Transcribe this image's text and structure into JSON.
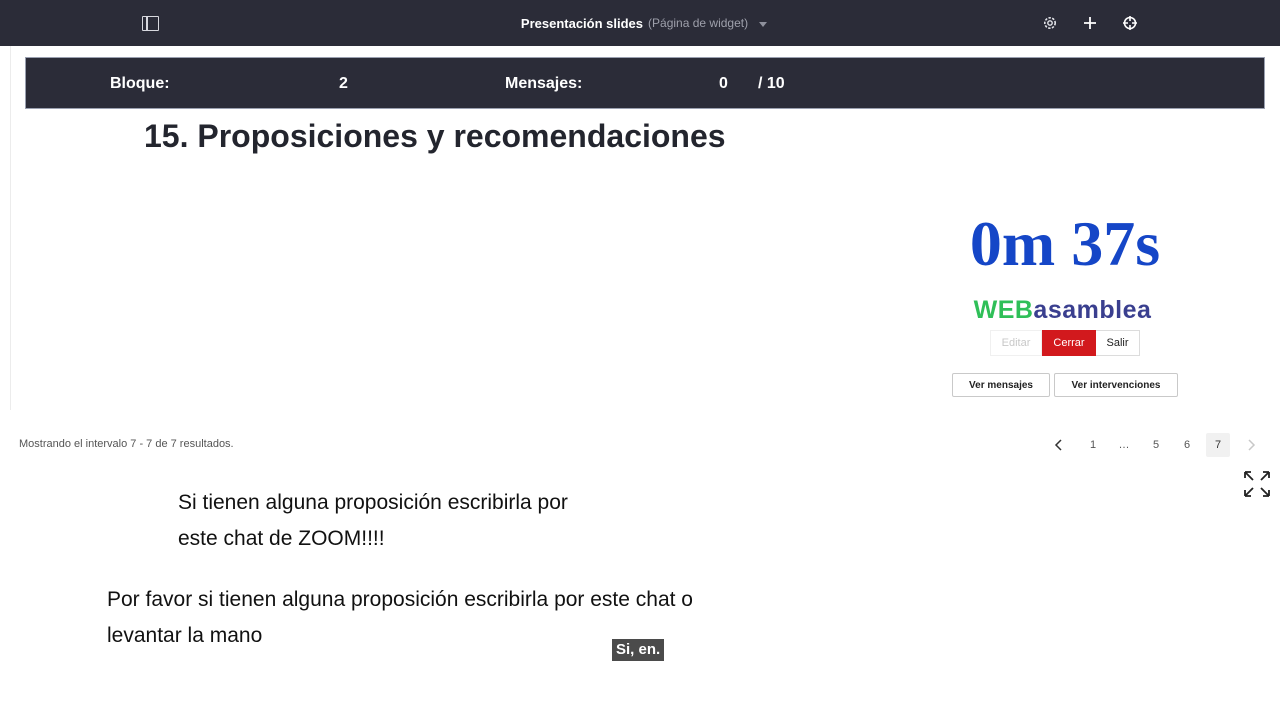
{
  "app": {
    "title": "Presentación slides",
    "subtitle": "(Página de widget)"
  },
  "status_bar": {
    "block_label": "Bloque:",
    "block_value": "2",
    "messages_label": "Mensajes:",
    "messages_value": "0",
    "messages_total": "/ 10"
  },
  "slide": {
    "heading": "15. Proposiciones y recomendaciones",
    "timer": "0m 37s",
    "logo_part1": "WEB",
    "logo_part2": "asamblea",
    "edit_label": "Editar",
    "close_label": "Cerrar",
    "exit_label": "Salir",
    "view_messages_label": "Ver mensajes",
    "view_interventions_label": "Ver intervenciones"
  },
  "pagination": {
    "summary": "Mostrando el intervalo 7 - 7 de 7 resultados.",
    "pages": [
      "1",
      "…",
      "5",
      "6",
      "7"
    ],
    "current": "7"
  },
  "captions": {
    "line1a": "Si tienen alguna proposición escribirla por",
    "line1b": "este chat de ZOOM!!!!",
    "line2a": "Por favor si tienen alguna proposición escribirla por este chat o",
    "line2b": "levantar la mano",
    "live_subtitle": "Si, en."
  },
  "colors": {
    "topbar": "#2b2c38",
    "timer": "#1546c7",
    "logo_web": "#2fbf58",
    "logo_asamblea": "#3a3f8f",
    "close_button": "#d2191d"
  },
  "icons": {
    "sidebar": "sidebar-toggle-icon",
    "settings": "gear-icon",
    "add": "plus-icon",
    "target": "crosshair-icon",
    "prev": "chevron-left-icon",
    "next": "chevron-right-icon",
    "fullscreen": "expand-icon"
  }
}
